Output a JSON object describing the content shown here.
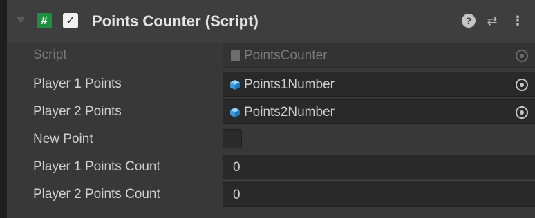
{
  "component": {
    "title": "Points Counter (Script)",
    "enabled": true,
    "icons": {
      "foldout": "foldout-arrow-icon",
      "script": "csharp-script-icon",
      "help": "help-icon",
      "preset": "preset-sliders-icon",
      "menu": "kebab-menu-icon"
    },
    "glyphs": {
      "script": "#",
      "check": "✓",
      "help": "?",
      "preset": "⇄",
      "menu": "⋮"
    }
  },
  "fields": {
    "script": {
      "label": "Script",
      "value": "PointsCounter"
    },
    "player1_points": {
      "label": "Player 1 Points",
      "value": "Points1Number"
    },
    "player2_points": {
      "label": "Player 2 Points",
      "value": "Points2Number"
    },
    "new_point": {
      "label": "New Point",
      "checked": false
    },
    "player1_count": {
      "label": "Player 1 Points Count",
      "value": "0"
    },
    "player2_count": {
      "label": "Player 2 Points Count",
      "value": "0"
    }
  },
  "colors": {
    "background": "#383838",
    "header": "#3e3e3e",
    "script_icon": "#1e8f3e",
    "gameobject_icon": "#4fb4f0"
  }
}
